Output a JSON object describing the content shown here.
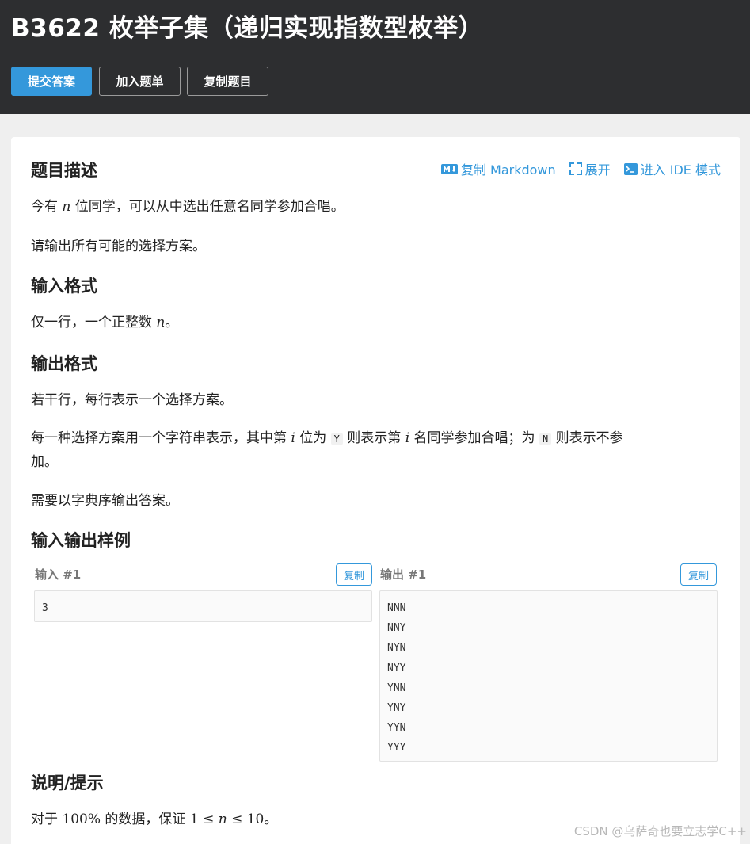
{
  "header": {
    "title": "B3622 枚举子集（递归实现指数型枚举）",
    "buttons": {
      "submit": "提交答案",
      "add_list": "加入题单",
      "copy_problem": "复制题目"
    }
  },
  "toolbar": {
    "copy_markdown": "复制 Markdown",
    "expand": "展开",
    "ide_mode": "进入 IDE 模式"
  },
  "sections": {
    "description": {
      "heading": "题目描述",
      "p1_before": "今有",
      "p1_var": "n",
      "p1_after": "位同学，可以从中选出任意名同学参加合唱。",
      "p2": "请输出所有可能的选择方案。"
    },
    "input_format": {
      "heading": "输入格式",
      "p1_before": "仅一行，一个正整数",
      "p1_var": "n",
      "p1_after": "。"
    },
    "output_format": {
      "heading": "输出格式",
      "p1": "若干行，每行表示一个选择方案。",
      "p2_a": "每一种选择方案用一个字符串表示，其中第",
      "p2_i": "i",
      "p2_b": "位为",
      "p2_Y": "Y",
      "p2_c": "则表示第",
      "p2_i2": "i",
      "p2_d": "名同学参加合唱；为",
      "p2_N": "N",
      "p2_e": "则表示不参",
      "p2_line2": "加。",
      "p3": "需要以字典序输出答案。"
    },
    "samples": {
      "heading": "输入输出样例",
      "input_label": "输入 #1",
      "output_label": "输出 #1",
      "copy_label": "复制",
      "input_value": "3",
      "output_value": "NNN\nNNY\nNYN\nNYY\nYNN\nYNY\nYYN\nYYY"
    },
    "hint": {
      "heading": "说明/提示",
      "p1_a": "对于",
      "p1_pct": "100%",
      "p1_b": "的数据，保证",
      "p1_expr_1": "1",
      "p1_le1": "≤",
      "p1_n": "n",
      "p1_le2": "≤",
      "p1_expr_10": "10",
      "p1_c": "。"
    }
  },
  "watermark": "CSDN @乌萨奇也要立志学C++",
  "colors": {
    "header_bg": "#2d2e30",
    "accent": "#3498db",
    "page_bg": "#efefef"
  }
}
